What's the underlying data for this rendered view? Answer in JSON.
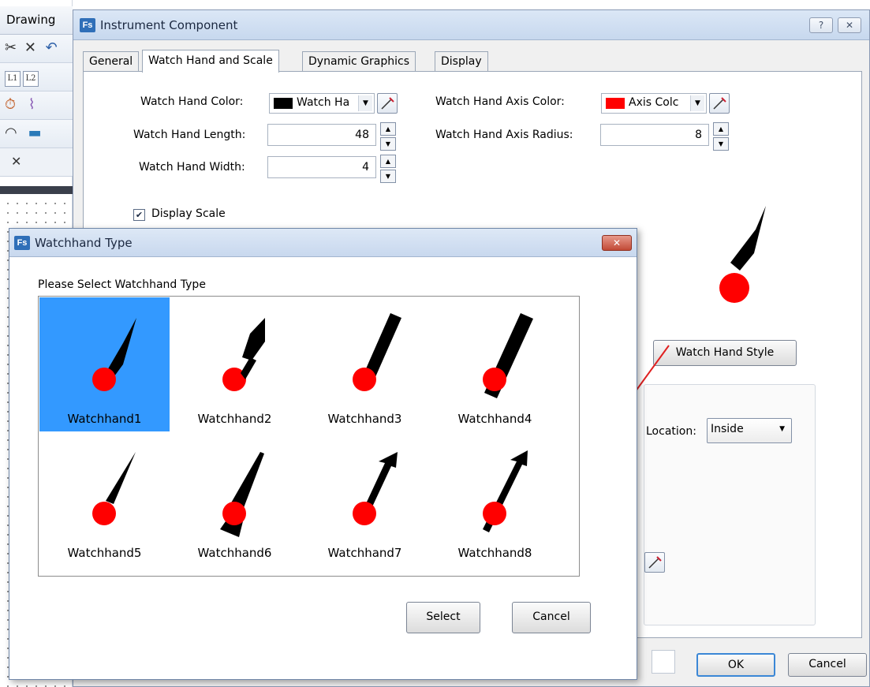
{
  "background": {
    "menu_label": "Drawing",
    "close_glyph": "✕"
  },
  "main_window": {
    "app_icon": "Fs",
    "title": "Instrument Component",
    "help_button": "?",
    "close_button": "✕",
    "tabs": [
      "General",
      "Watch Hand and Scale",
      "Dynamic Graphics",
      "Display"
    ],
    "active_tab": "Watch Hand and Scale",
    "watch_hand_color_label": "Watch Hand Color:",
    "watch_hand_color_value": "Watch Ha",
    "watch_hand_color_hex": "#000000",
    "watch_hand_length_label": "Watch Hand Length:",
    "watch_hand_length_value": "48",
    "watch_hand_width_label": "Watch Hand Width:",
    "watch_hand_width_value": "4",
    "axis_color_label": "Watch Hand Axis Color:",
    "axis_color_value": "Axis Colc",
    "axis_color_hex": "#ff0000",
    "axis_radius_label": "Watch Hand Axis Radius:",
    "axis_radius_value": "8",
    "display_scale_label": "Display Scale",
    "display_scale_checked": true,
    "watch_hand_style_button": "Watch Hand Style",
    "location_label": "Location:",
    "location_value": "Inside",
    "ok_button": "OK",
    "cancel_button": "Cancel"
  },
  "dialog": {
    "app_icon": "Fs",
    "title": "Watchhand Type",
    "close_button": "✕",
    "prompt": "Please Select Watchhand Type",
    "selected_index": 0,
    "items": [
      {
        "label": "Watchhand1",
        "style": "tapered"
      },
      {
        "label": "Watchhand2",
        "style": "short-block"
      },
      {
        "label": "Watchhand3",
        "style": "thick-bar"
      },
      {
        "label": "Watchhand4",
        "style": "thick-bar-tail"
      },
      {
        "label": "Watchhand5",
        "style": "thin-tapered"
      },
      {
        "label": "Watchhand6",
        "style": "tapered-tail"
      },
      {
        "label": "Watchhand7",
        "style": "arrow"
      },
      {
        "label": "Watchhand8",
        "style": "arrow-tail"
      }
    ],
    "select_button": "Select",
    "cancel_button": "Cancel",
    "selection_color": "#3399ff",
    "hub_color": "#ff0000",
    "hand_color": "#000000"
  }
}
